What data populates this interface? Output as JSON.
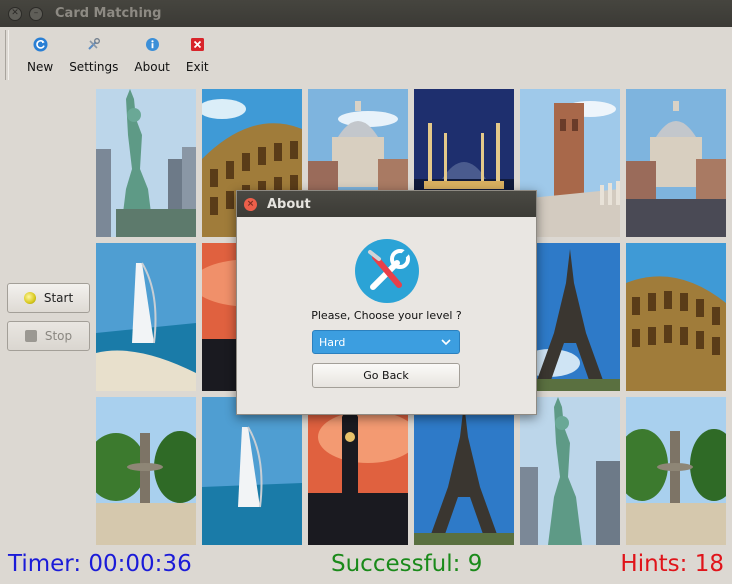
{
  "window": {
    "title": "Card Matching"
  },
  "toolbar": {
    "new_label": "New",
    "settings_label": "Settings",
    "about_label": "About",
    "exit_label": "Exit"
  },
  "side": {
    "start_label": "Start",
    "stop_label": "Stop"
  },
  "cards": [
    "statue-of-liberty",
    "colosseum",
    "st-pauls-cathedral",
    "blue-mosque",
    "hassan-tower",
    "st-pauls-cathedral",
    "burj-al-arab",
    "big-ben",
    "hidden",
    "hidden",
    "eiffel-tower",
    "colosseum",
    "fountain",
    "burj-al-arab",
    "big-ben",
    "eiffel-tower",
    "statue-of-liberty",
    "fountain"
  ],
  "status": {
    "timer": "Timer: 00:00:36",
    "successful": "Successful: 9",
    "hints": "Hints: 18",
    "colors": {
      "timer": "#1b1bd8",
      "successful": "#1a8a1a",
      "hints": "#e0141a"
    }
  },
  "dialog": {
    "title": "About",
    "prompt": "Please, Choose your level ?",
    "level_selected": "Hard",
    "go_back_label": "Go Back",
    "icon": "tools-icon"
  }
}
